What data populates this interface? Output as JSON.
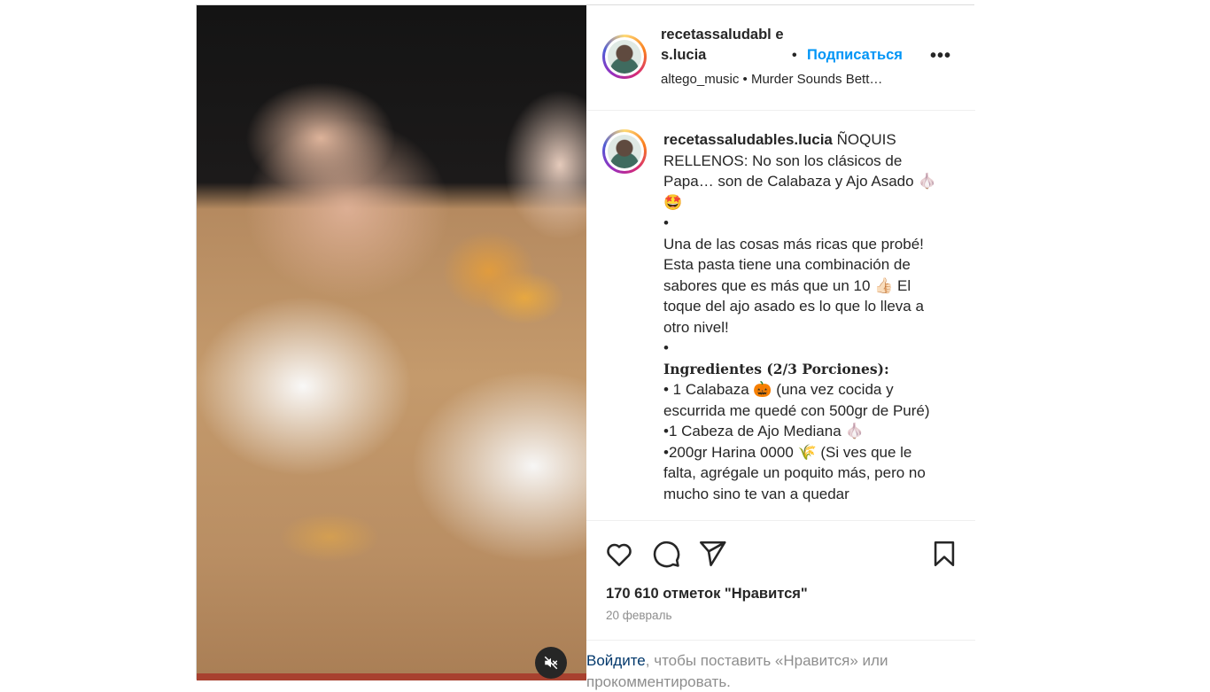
{
  "post": {
    "username": "recetassaludables.lucia",
    "username_wrapped": "recetassaludabl es.lucia",
    "follow_label": "Подписаться",
    "separator": "•",
    "more_label": "•••",
    "audio": "altego_music • Murder Sounds Bett…",
    "caption": {
      "username": "recetassaludables.lucia",
      "text_1": " ÑOQUIS RELLENOS: No son los clásicos de Papa… son de Calabaza y Ajo Asado 🧄🤩\n•\nUna de las cosas más ricas que probé! Esta pasta tiene una combinación de sabores que es más que un 10 👍🏻 El toque del ajo asado es lo que lo lleva a otro nivel!\n•\n",
      "ingredients_heading": "Ingredientes (2/3 Porciones):",
      "text_2": "\n• 1 Calabaza 🎃 (una vez cocida y escurrida me quedé con 500gr de Puré)\n•1 Cabeza de Ajo Mediana 🧄\n•200gr Harina 0000 🌾 (Si ves que le falta, agrégale un poquito más, pero no mucho sino te van a quedar"
    },
    "likes": "170 610 отметок \"Нравится\"",
    "date": "20 февраль",
    "login_link": "Войдите",
    "login_text": ", чтобы поставить «Нравится» или прокомментировать."
  },
  "icons": [
    "like-icon",
    "comment-icon",
    "share-icon",
    "save-icon",
    "mute-icon",
    "more-icon"
  ]
}
